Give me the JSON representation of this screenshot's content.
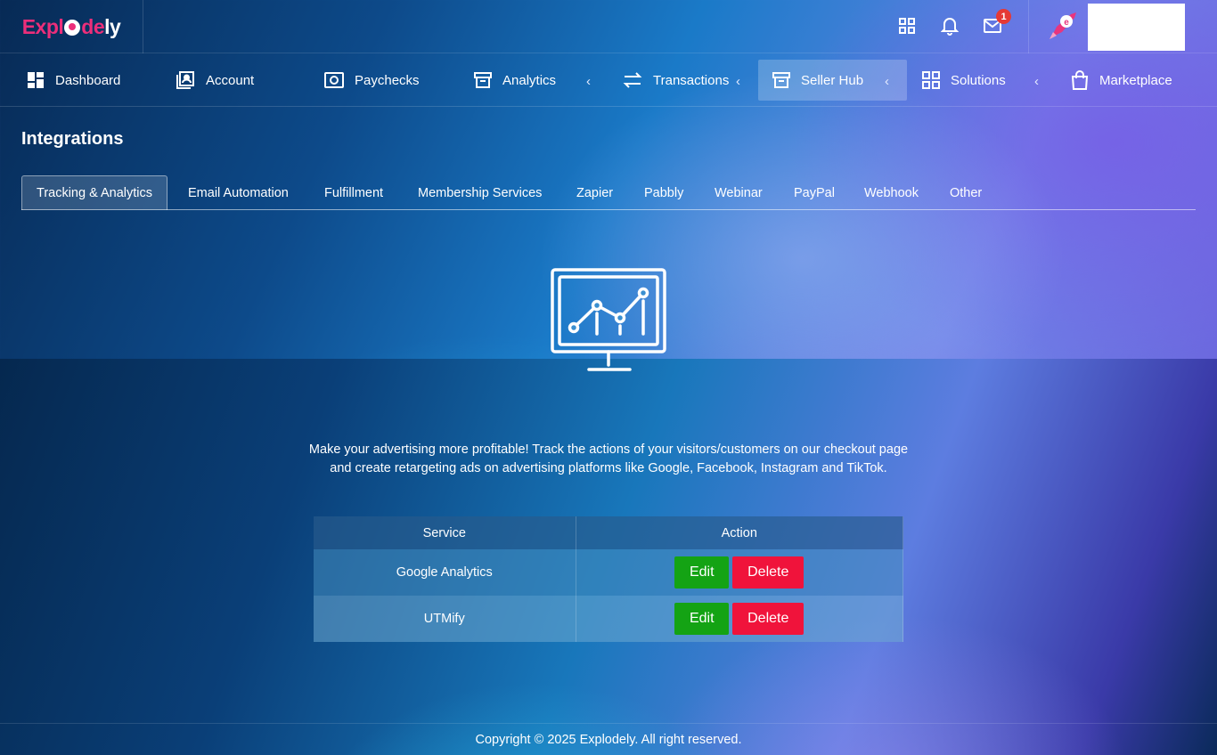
{
  "brand": {
    "logo_part1": "Expl",
    "logo_part2": "de",
    "logo_part3": "ly",
    "pink": "#ec2e7a"
  },
  "topbar": {
    "icons": [
      "apps-grid-icon",
      "bell-icon",
      "mail-icon"
    ],
    "mail_badge": "1"
  },
  "nav": {
    "items": [
      {
        "label": "Dashboard",
        "icon": "dashboard-icon"
      },
      {
        "label": "Account",
        "icon": "account-icon"
      },
      {
        "label": "Paychecks",
        "icon": "paycheck-icon"
      },
      {
        "label": "Analytics",
        "icon": "archive-icon"
      },
      {
        "label": "Transactions",
        "icon": "transfer-icon"
      },
      {
        "label": "Seller Hub",
        "icon": "archive-icon"
      },
      {
        "label": "Solutions",
        "icon": "grid-icon"
      },
      {
        "label": "Marketplace",
        "icon": "bag-icon"
      }
    ],
    "active": "Seller Hub"
  },
  "page": {
    "title": "Integrations",
    "tabs": [
      "Tracking & Analytics",
      "Email Automation",
      "Fulfillment",
      "Membership Services",
      "Zapier",
      "Pabbly",
      "Webinar",
      "PayPal",
      "Webhook",
      "Other"
    ],
    "active_tab": "Tracking & Analytics",
    "description": "Make your advertising more profitable! Track the actions of your visitors/customers on our checkout page and create retargeting ads on advertising platforms like Google, Facebook, Instagram and TikTok."
  },
  "table": {
    "headers": [
      "Service",
      "Action"
    ],
    "rows": [
      {
        "service": "Google Analytics",
        "edit": "Edit",
        "delete": "Delete"
      },
      {
        "service": "UTMify",
        "edit": "Edit",
        "delete": "Delete"
      }
    ],
    "edit_color": "#14a314",
    "delete_color": "#f0133b"
  },
  "footer": {
    "text": "Copyright © 2025 Explodely. All right reserved."
  }
}
